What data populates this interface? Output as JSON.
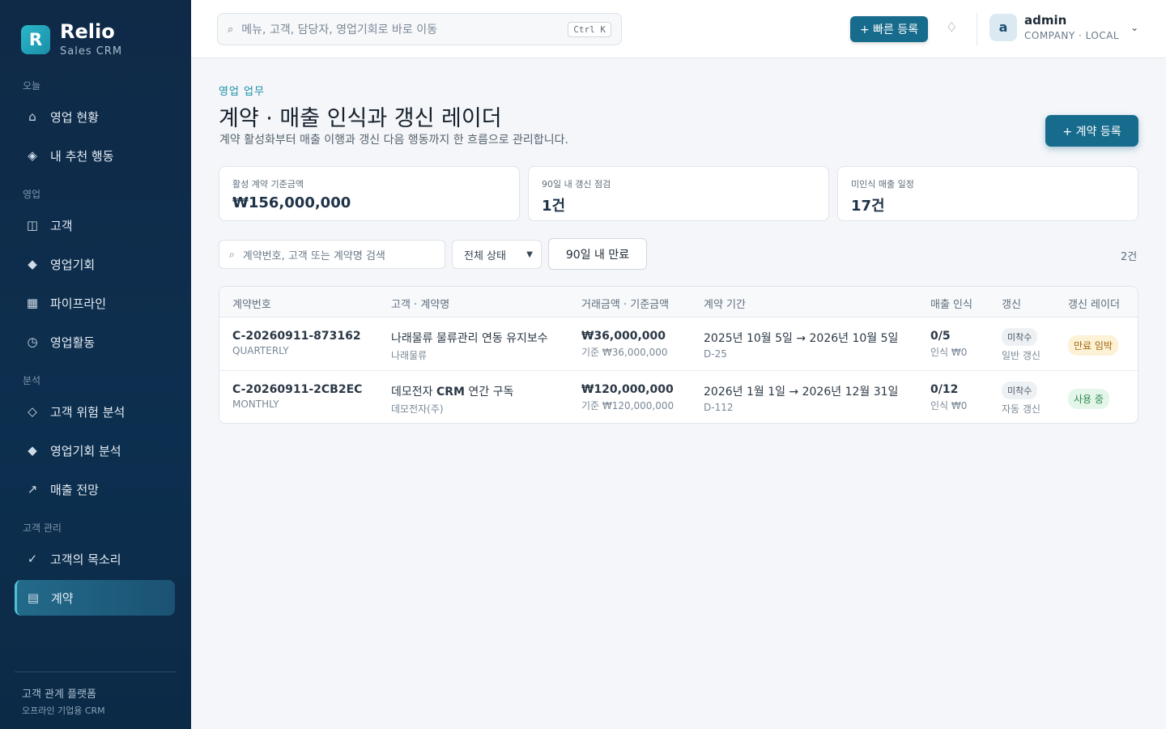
{
  "brand": {
    "logo_letter": "R",
    "name": "Relio",
    "sub": "Sales CRM"
  },
  "sidebar": {
    "sections": [
      "오늘",
      "영업",
      "분석",
      "고객 관리"
    ],
    "items": [
      {
        "label": "영업 현황",
        "icon": "⌂"
      },
      {
        "label": "내 추천 행동",
        "icon": "◈"
      },
      {
        "label": "고객",
        "icon": "◫"
      },
      {
        "label": "영업기회",
        "icon": "◆"
      },
      {
        "label": "파이프라인",
        "icon": "▦"
      },
      {
        "label": "영업활동",
        "icon": "◷"
      },
      {
        "label": "고객 위험 분석",
        "icon": "◇"
      },
      {
        "label": "영업기회 분석",
        "icon": "◆"
      },
      {
        "label": "매출 전망",
        "icon": "↗"
      },
      {
        "label": "고객의 목소리",
        "icon": "✓"
      },
      {
        "label": "계약",
        "icon": "▤"
      }
    ],
    "footer_title": "고객 관계 플랫폼",
    "footer_sub": "오프라인 기업용 CRM"
  },
  "topbar": {
    "search_placeholder": "메뉴, 고객, 담당자, 영업기회로 바로 이동",
    "search_shortcut": "Ctrl K",
    "quick_add_label": "+ 빠른 등록",
    "notify_icon": "♢",
    "user": {
      "initial": "a",
      "name": "admin",
      "org": "COMPANY · LOCAL",
      "chevron": "⌄"
    }
  },
  "page": {
    "eyebrow": "영업 업무",
    "title": "계약 · 매출 인식과 갱신 레이더",
    "subtitle": "계약 활성화부터 매출 이행과 갱신 다음 행동까지 한 흐름으로 관리합니다.",
    "add_contract_label": "+ 계약 등록"
  },
  "stats": [
    {
      "label": "활성 계약 기준금액",
      "value": "₩156,000,000"
    },
    {
      "label": "90일 내 갱신 점검",
      "value": "1건"
    },
    {
      "label": "미인식 매출 일정",
      "value": "17건"
    }
  ],
  "filters": {
    "search_placeholder": "계약번호, 고객 또는 계약명 검색",
    "status_selected": "전체 상태",
    "expiry_label": "90일 내 만료",
    "count": "2건"
  },
  "table": {
    "headers": [
      "계약번호",
      "고객 · 계약명",
      "거래금액 · 기준금액",
      "계약 기간",
      "매출 인식",
      "갱신",
      "갱신 레이더"
    ],
    "rows": [
      {
        "contract_no": "C-20260911-873162",
        "cycle": "QUARTERLY",
        "name_prefix": "나래물류 물류관리 연동 유지보수",
        "name_bold": "",
        "name_suffix": "",
        "customer": "나래물류",
        "amount": "₩36,000,000",
        "base_amount": "기준 ₩36,000,000",
        "period": "2025년 10월 5일 → 2026년 10월 5일",
        "dday": "D-25",
        "recognition": "0/5",
        "recognized": "인식 ₩0",
        "renewal_status": "미착수",
        "renewal_type": "일반 갱신",
        "radar": "만료 임박",
        "radar_color": "#fdf1d6"
      },
      {
        "contract_no": "C-20260911-2CB2EC",
        "cycle": "MONTHLY",
        "name_prefix": "데모전자 ",
        "name_bold": "CRM",
        "name_suffix": " 연간 구독",
        "customer": "데모전자(주)",
        "amount": "₩120,000,000",
        "base_amount": "기준 ₩120,000,000",
        "period": "2026년 1월 1일 → 2026년 12월 31일",
        "dday": "D-112",
        "recognition": "0/12",
        "recognized": "인식 ₩0",
        "renewal_status": "미착수",
        "renewal_type": "자동 갱신",
        "radar": "사용 중",
        "radar_color": "#e4f6ea"
      }
    ]
  }
}
